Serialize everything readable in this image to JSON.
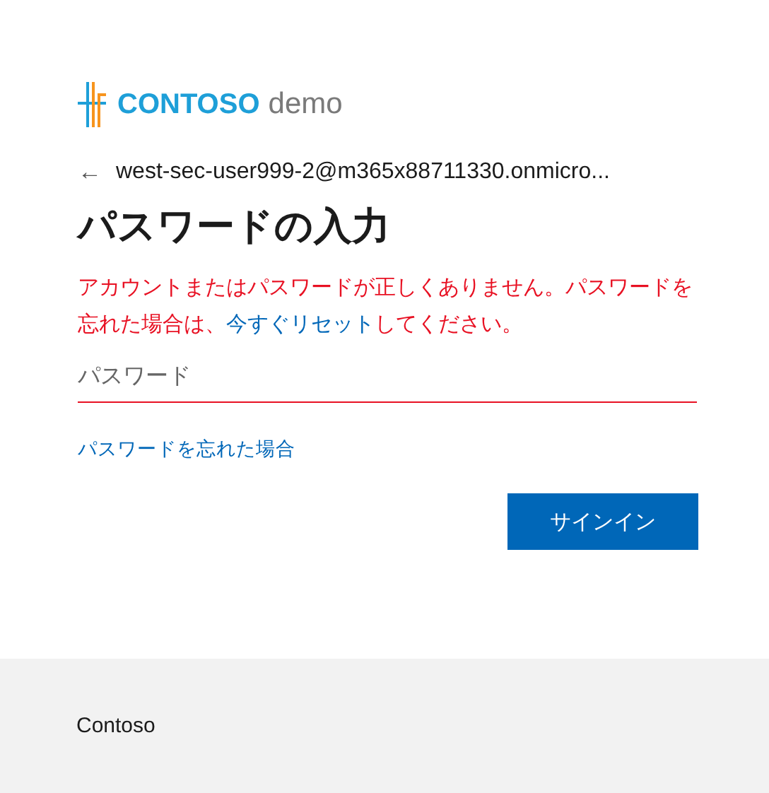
{
  "logo": {
    "brand": "CONTOSO",
    "suffix": "demo"
  },
  "account": {
    "back_icon": "←",
    "email": "west-sec-user999-2@m365x88711330.onmicro..."
  },
  "title": "パスワードの入力",
  "error": {
    "before": "アカウントまたはパスワードが正しくありません。パスワードを忘れた場合は、",
    "link": "今すぐリセット",
    "after": "してください。"
  },
  "password": {
    "placeholder": "パスワード",
    "invalid": true
  },
  "forgot_link": "パスワードを忘れた場合",
  "sign_in_button": "サインイン",
  "footer": {
    "text": "Contoso"
  }
}
